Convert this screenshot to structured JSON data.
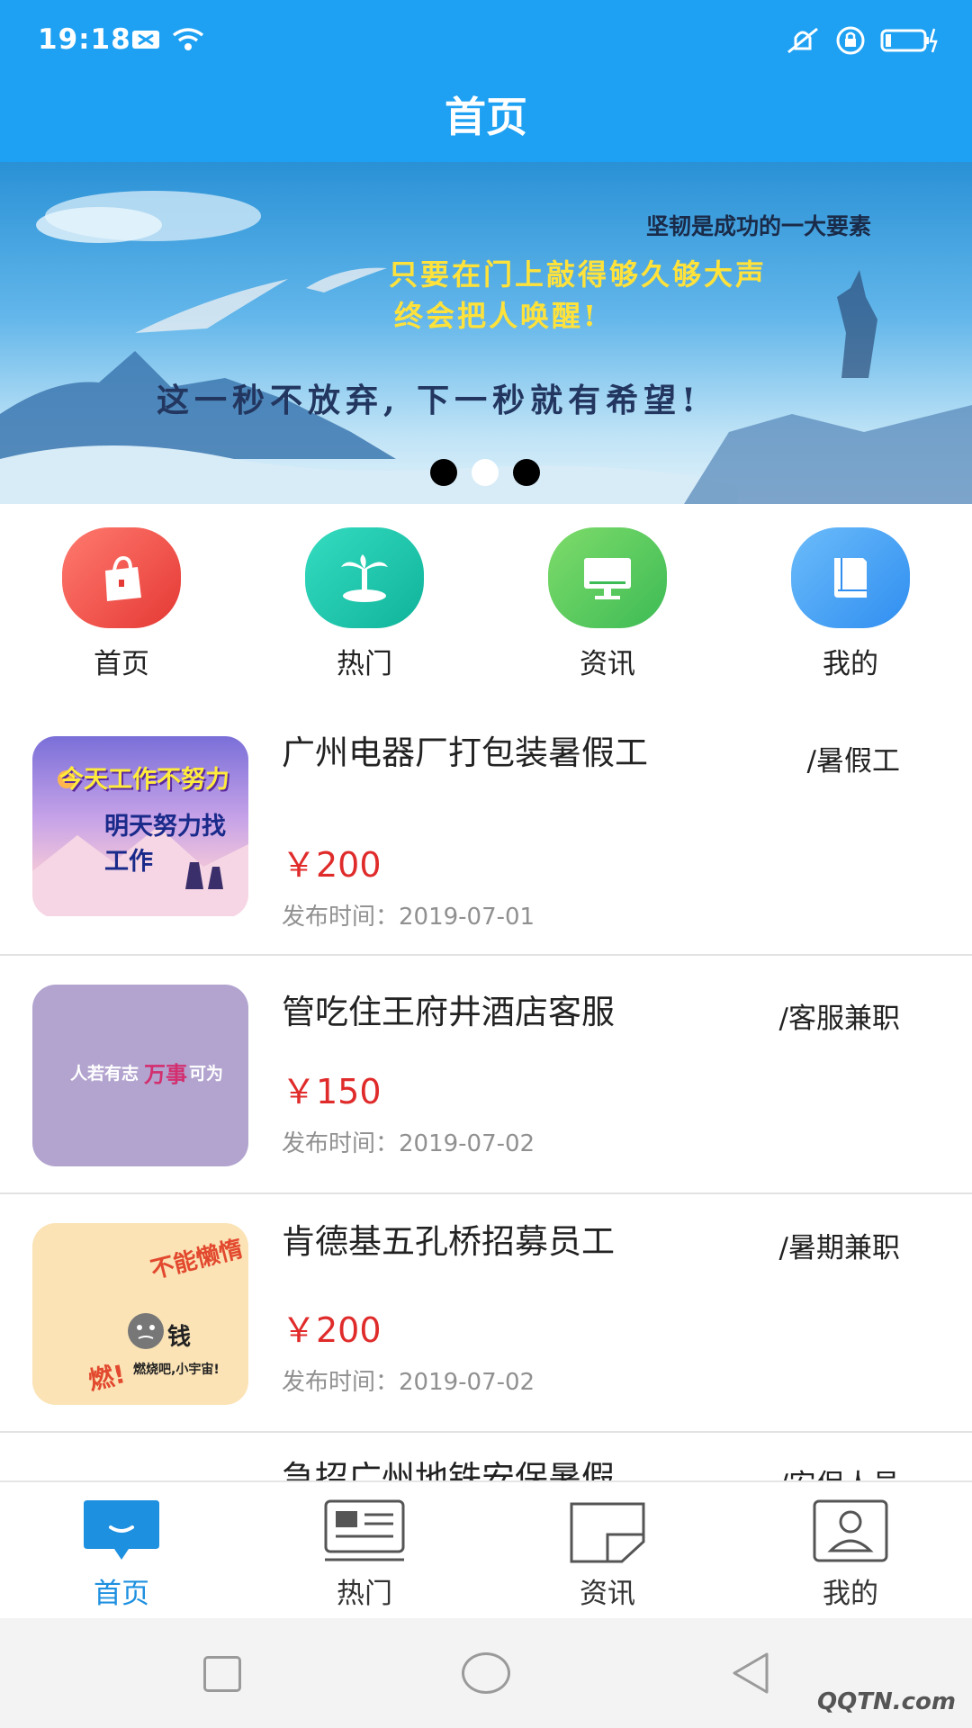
{
  "status_bar": {
    "time": "19:18"
  },
  "header": {
    "title": "首页"
  },
  "banner": {
    "line1": "坚韧是成功的一大要素",
    "line2": "只要在门上敲得够久够大声",
    "line3": "终会把人唤醒!",
    "line4": "这一秒不放弃, 下一秒就有希望!",
    "slide_count": 3,
    "active_slide": 2
  },
  "categories": [
    {
      "label": "首页",
      "icon": "shopping-bag-icon",
      "color": "#ef5350"
    },
    {
      "label": "热门",
      "icon": "palm-island-icon",
      "color": "#1cc5a8"
    },
    {
      "label": "资讯",
      "icon": "monitor-icon",
      "color": "#5ccf62"
    },
    {
      "label": "我的",
      "icon": "book-icon",
      "color": "#4aa6f5"
    }
  ],
  "jobs": [
    {
      "title": "广州电器厂打包装暑假工",
      "tag": "/暑假工",
      "price": "￥200",
      "date": "发布时间：2019-07-01",
      "thumb_line1": "今天工作不努力",
      "thumb_line2": "明天努力找工作"
    },
    {
      "title": "管吃住王府井酒店客服",
      "tag": "/客服兼职",
      "price": "￥150",
      "date": "发布时间：2019-07-02",
      "thumb_line1": "人若有志",
      "thumb_line2": "万事",
      "thumb_line3": "可为"
    },
    {
      "title": "肯德基五孔桥招募员工",
      "tag": "/暑期兼职",
      "price": "￥200",
      "date": "发布时间：2019-07-02",
      "thumb_line1": "不能懒惰",
      "thumb_line2": "钱",
      "thumb_line3": "燃!",
      "thumb_line4": "燃烧吧,小宇宙!"
    },
    {
      "title": "急招广州地铁安保暑假",
      "tag": "/安保人员"
    }
  ],
  "bottom_nav": [
    {
      "label": "首页",
      "icon": "chat-bubble-icon",
      "active": true
    },
    {
      "label": "热门",
      "icon": "news-card-icon",
      "active": false
    },
    {
      "label": "资讯",
      "icon": "document-icon",
      "active": false
    },
    {
      "label": "我的",
      "icon": "profile-card-icon",
      "active": false
    }
  ],
  "colors": {
    "primary": "#1ea1f3",
    "price": "#e02b2b",
    "active_nav": "#1e90e0"
  },
  "watermark": "QQTN.com"
}
